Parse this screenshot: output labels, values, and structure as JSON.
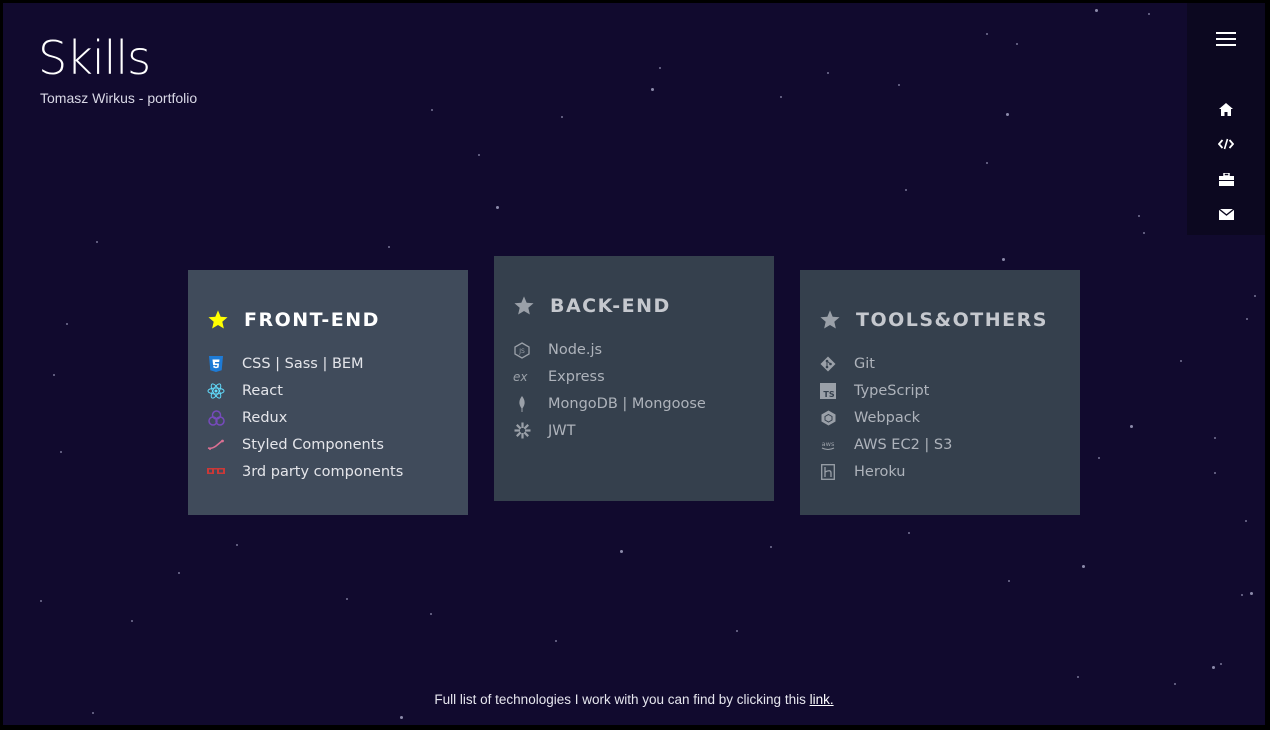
{
  "header": {
    "title": "Skills",
    "subtitle": "Tomasz Wirkus - portfolio"
  },
  "nav": {
    "menu_icon": "hamburger-menu-icon",
    "items": [
      {
        "icon": "home-icon"
      },
      {
        "icon": "code-icon"
      },
      {
        "icon": "briefcase-icon"
      },
      {
        "icon": "envelope-icon"
      }
    ]
  },
  "cards": {
    "frontend": {
      "title": "FRONT-END",
      "star_color": "#ffff00",
      "items": [
        {
          "label": "CSS | Sass | BEM",
          "icon": "css3-icon"
        },
        {
          "label": "React",
          "icon": "react-icon"
        },
        {
          "label": "Redux",
          "icon": "redux-icon"
        },
        {
          "label": "Styled Components",
          "icon": "styled-components-icon"
        },
        {
          "label": "3rd party components",
          "icon": "npm-icon"
        }
      ]
    },
    "backend": {
      "title": "BACK-END",
      "star_color": "#9aa0a8",
      "items": [
        {
          "label": "Node.js",
          "icon": "nodejs-icon"
        },
        {
          "label": "Express",
          "icon": "express-icon"
        },
        {
          "label": "MongoDB | Mongoose",
          "icon": "mongodb-icon"
        },
        {
          "label": "JWT",
          "icon": "jwt-icon"
        }
      ]
    },
    "tools": {
      "title": "TOOLS&OTHERS",
      "star_color": "#9aa0a8",
      "items": [
        {
          "label": "Git",
          "icon": "git-icon"
        },
        {
          "label": "TypeScript",
          "icon": "typescript-icon"
        },
        {
          "label": "Webpack",
          "icon": "webpack-icon"
        },
        {
          "label": "AWS EC2 | S3",
          "icon": "aws-icon"
        },
        {
          "label": "Heroku",
          "icon": "heroku-icon"
        }
      ]
    }
  },
  "footer": {
    "text": "Full list of technologies I work with you can find by clicking this ",
    "link_label": "link."
  },
  "colors": {
    "background": "#110a2e",
    "card_active": "#404b5b",
    "card": "#35404d",
    "sidebar": "#0c0820"
  }
}
